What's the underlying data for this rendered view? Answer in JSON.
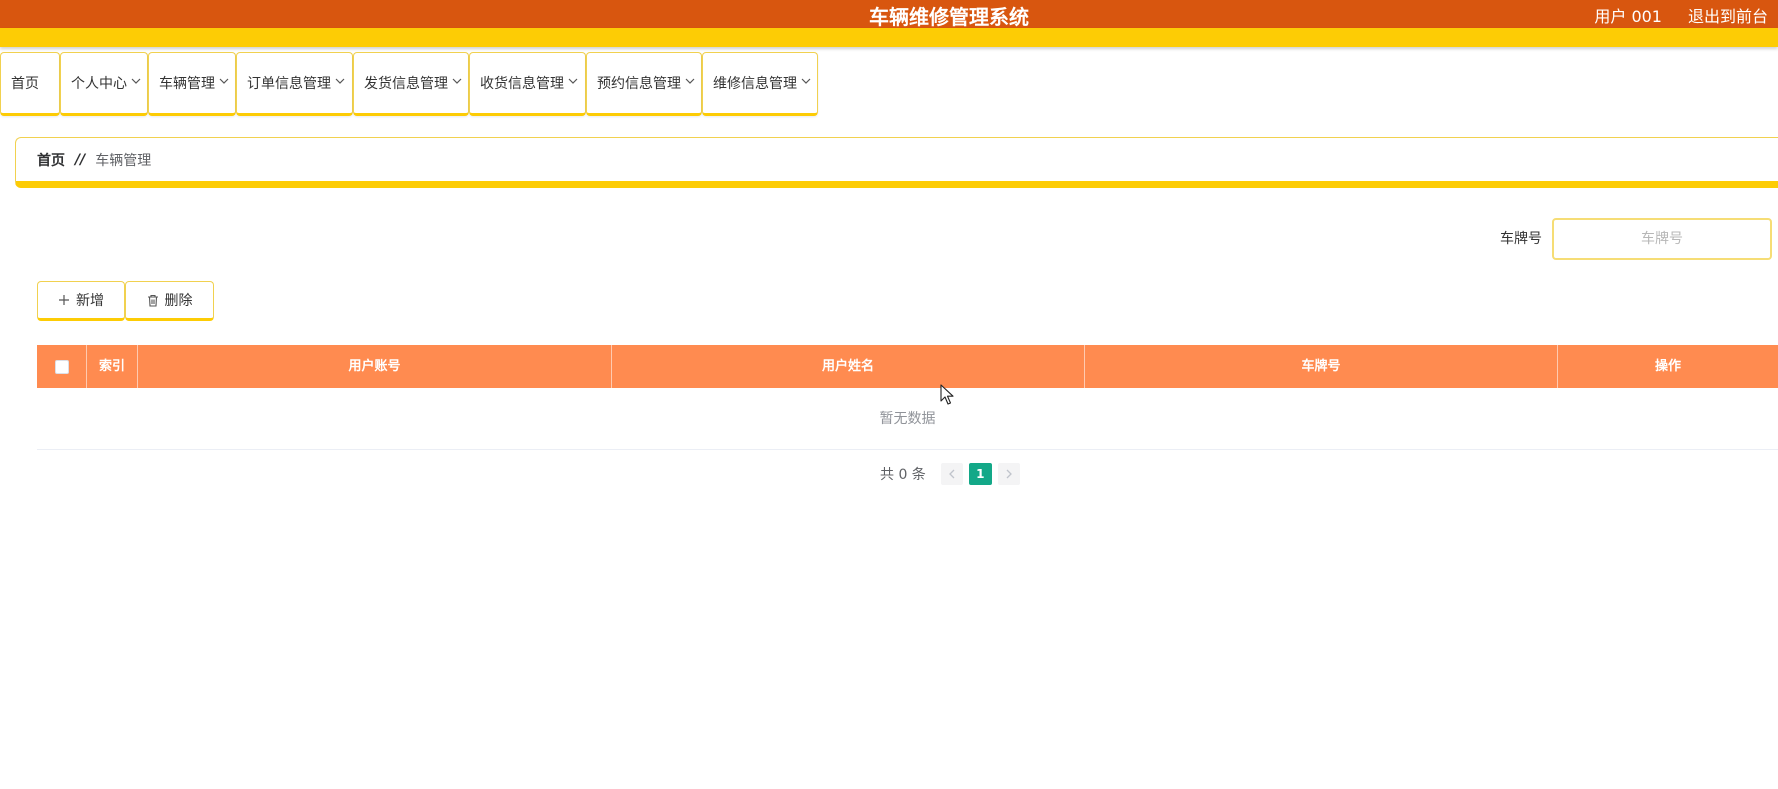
{
  "header": {
    "title": "车辆维修管理系统",
    "user": "用户 001",
    "exit_label": "退出到前台"
  },
  "nav": {
    "items": [
      {
        "label": "首页",
        "dropdown": false
      },
      {
        "label": "个人中心",
        "dropdown": true
      },
      {
        "label": "车辆管理",
        "dropdown": true
      },
      {
        "label": "订单信息管理",
        "dropdown": true
      },
      {
        "label": "发货信息管理",
        "dropdown": true
      },
      {
        "label": "收货信息管理",
        "dropdown": true
      },
      {
        "label": "预约信息管理",
        "dropdown": true
      },
      {
        "label": "维修信息管理",
        "dropdown": true
      }
    ]
  },
  "breadcrumb": {
    "home": "首页",
    "separator": "//",
    "current": "车辆管理"
  },
  "search": {
    "label": "车牌号",
    "placeholder": "车牌号",
    "value": ""
  },
  "toolbar": {
    "add_label": "新增",
    "delete_label": "删除"
  },
  "table": {
    "columns": [
      "索引",
      "用户账号",
      "用户姓名",
      "车牌号",
      "操作"
    ],
    "rows": [],
    "empty_text": "暂无数据"
  },
  "pagination": {
    "total_text": "共 0 条",
    "current_page": "1"
  },
  "colors": {
    "header_bg": "#d8560f",
    "accent_yellow": "#fdcc05",
    "table_header_bg": "#ff8b50",
    "page_active": "#13a888"
  }
}
